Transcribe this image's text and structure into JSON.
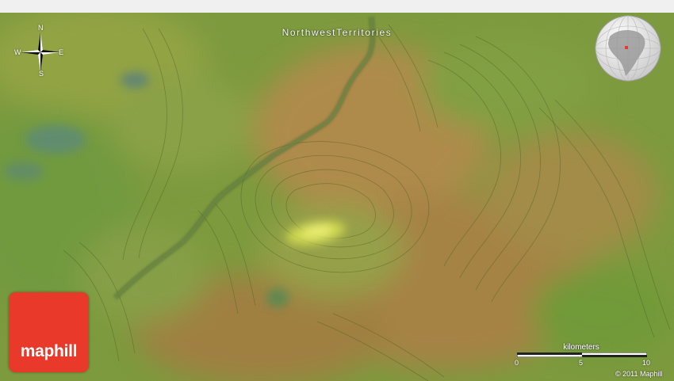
{
  "map": {
    "region_label": "NorthwestTerritories",
    "brand": "maphill",
    "copyright": "© 2011 Maphill",
    "colors": {
      "vegetation": "#6f9a38",
      "dry_ground": "#b8844a",
      "river": "#3d5a2a",
      "highlight": "#d8e050",
      "logo": "#e8392a"
    }
  },
  "compass": {
    "north": "N",
    "south": "S",
    "east": "E",
    "west": "W"
  },
  "scale": {
    "title": "kilometers",
    "ticks": [
      "0",
      "5",
      "10"
    ]
  },
  "globe": {
    "icon": "globe-locator-icon"
  }
}
